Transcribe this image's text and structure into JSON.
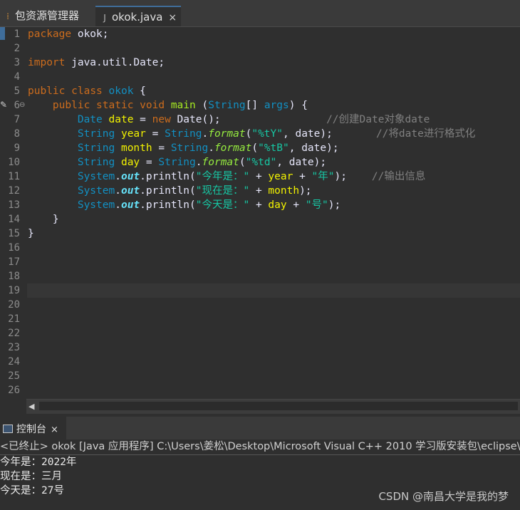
{
  "tabs": {
    "package_explorer": {
      "label": "包资源管理器"
    },
    "editor": {
      "label": "okok.java",
      "close": "×"
    }
  },
  "editor": {
    "line_numbers": [
      "1",
      "2",
      "3",
      "4",
      "5",
      "6",
      "7",
      "8",
      "9",
      "10",
      "11",
      "12",
      "13",
      "14",
      "15",
      "16",
      "17",
      "18",
      "19",
      "20",
      "21",
      "22",
      "23",
      "24",
      "25",
      "26"
    ],
    "lines": {
      "l1": {
        "kw": "package",
        "rest": " okok;"
      },
      "l3": {
        "kw": "import",
        "rest": " java.util.Date;"
      },
      "l5": {
        "kw1": "public",
        "kw2": "class",
        "cls": "okok",
        "rest": " {"
      },
      "l6": {
        "kw1": "public",
        "kw2": "static",
        "kw3": "void",
        "method": "main",
        "p1": " (",
        "type": "String",
        "p2": "[] ",
        "var": "args",
        "p3": ") {"
      },
      "l7": {
        "type": "Date",
        "var": "date",
        "eq": " = ",
        "kw": "new",
        "ctor": " Date();",
        "comment": "//创建Date对象date"
      },
      "l8": {
        "type": "String",
        "var": "year",
        "eq": " = ",
        "cls": "String",
        "dot": ".",
        "method": "format",
        "open": "(",
        "str": "\"%tY\"",
        "args": ", date);",
        "comment": "//将date进行格式化"
      },
      "l9": {
        "type": "String",
        "var": "month",
        "eq": " = ",
        "cls": "String",
        "dot": ".",
        "method": "format",
        "open": "(",
        "str": "\"%tB\"",
        "args": ", date);"
      },
      "l10": {
        "type": "String",
        "var": "day",
        "eq": " = ",
        "cls": "String",
        "dot": ".",
        "method": "format",
        "open": "(",
        "str": "\"%td\"",
        "args": ", date);"
      },
      "l11": {
        "cls": "System",
        "dot": ".",
        "field": "out",
        "call": ".println(",
        "str1": "\"今年是：\"",
        "plus1": " + ",
        "var": "year",
        "plus2": " + ",
        "str2": "\"年\"",
        "end": ");",
        "comment": "//输出信息"
      },
      "l12": {
        "cls": "System",
        "dot": ".",
        "field": "out",
        "call": ".println(",
        "str1": "\"现在是：\"",
        "plus1": " + ",
        "var": "month",
        "end": ");"
      },
      "l13": {
        "cls": "System",
        "dot": ".",
        "field": "out",
        "call": ".println(",
        "str1": "\"今天是：\"",
        "plus1": " + ",
        "var": "day",
        "plus2": " + ",
        "str2": "\"号\"",
        "end": ");"
      },
      "l14": {
        "text": "}"
      },
      "l15": {
        "text": "}"
      }
    }
  },
  "console": {
    "tab_label": "控制台",
    "close": "×",
    "status": "<已终止> okok [Java 应用程序] C:\\Users\\姜松\\Desktop\\Microsoft Visual C++ 2010 学习版安装包\\eclipse\\",
    "output": [
      "今年是：2022年",
      "现在是：三月",
      "今天是：27号"
    ]
  },
  "watermark": "CSDN @南昌大学是我的梦",
  "colors": {
    "background": "#2f2f2f",
    "keyword": "#cc6c1d",
    "type": "#1290c3",
    "variable": "#f2f200",
    "string": "#17c6a3",
    "comment": "#808080"
  },
  "icons": {
    "package_explorer": "package-explorer-icon",
    "java_file": "java-file-icon",
    "console": "console-icon"
  }
}
